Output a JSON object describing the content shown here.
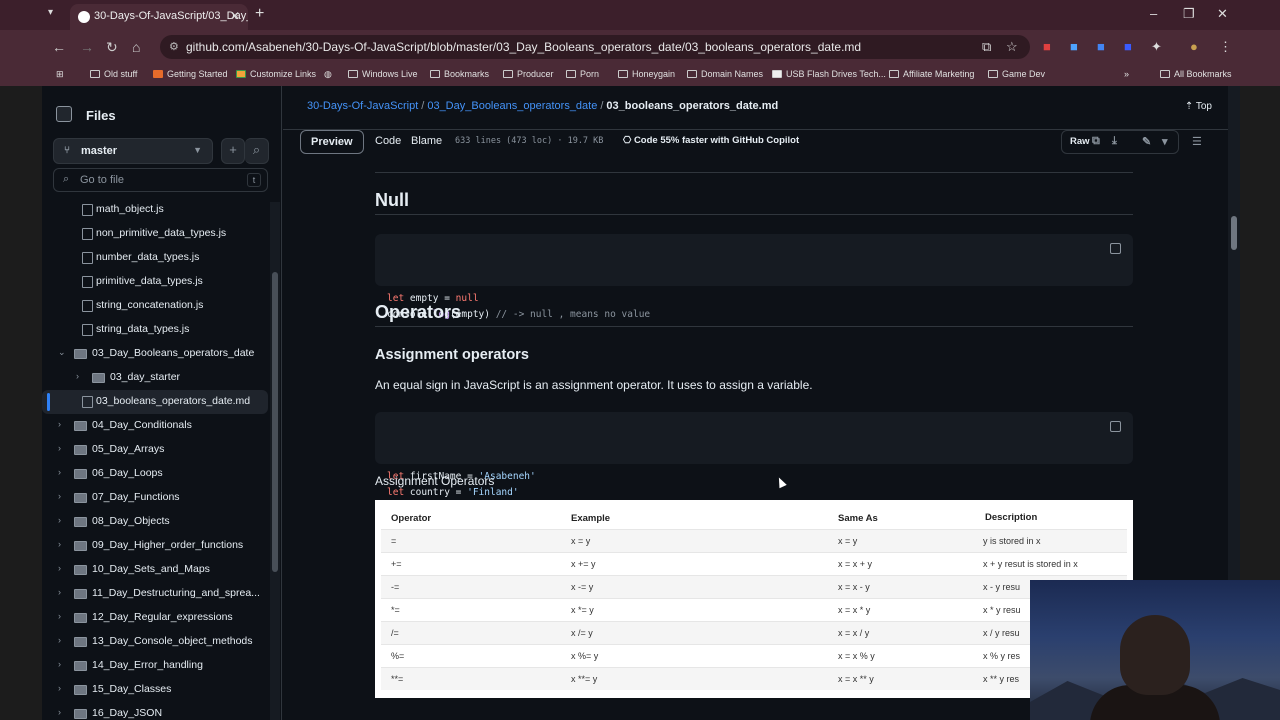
{
  "browser": {
    "tab_title": "30-Days-Of-JavaScript/03_Day_Bo...",
    "url": "github.com/Asabeneh/30-Days-Of-JavaScript/blob/master/03_Day_Booleans_operators_date/03_booleans_operators_date.md",
    "bookmarks": [
      "Old stuff",
      "Getting Started",
      "Customize Links",
      "Windows Live",
      "Bookmarks",
      "Producer",
      "Porn",
      "Honeygain",
      "Domain Names",
      "USB Flash Drives Tech...",
      "Affiliate Marketing",
      "Game Dev"
    ],
    "all_bookmarks": "All Bookmarks"
  },
  "sidebar": {
    "title": "Files",
    "branch": "master",
    "go_to_file": "Go to file",
    "go_to_file_key": "t",
    "items": [
      {
        "label": "math_object.js",
        "type": "file",
        "indent": 2
      },
      {
        "label": "non_primitive_data_types.js",
        "type": "file",
        "indent": 2
      },
      {
        "label": "number_data_types.js",
        "type": "file",
        "indent": 2
      },
      {
        "label": "primitive_data_types.js",
        "type": "file",
        "indent": 2
      },
      {
        "label": "string_concatenation.js",
        "type": "file",
        "indent": 2
      },
      {
        "label": "string_data_types.js",
        "type": "file",
        "indent": 2
      },
      {
        "label": "03_Day_Booleans_operators_date",
        "type": "folder-open",
        "indent": 1
      },
      {
        "label": "03_day_starter",
        "type": "folder",
        "indent": 2
      },
      {
        "label": "03_booleans_operators_date.md",
        "type": "file",
        "indent": 2,
        "selected": true
      },
      {
        "label": "04_Day_Conditionals",
        "type": "folder",
        "indent": 1
      },
      {
        "label": "05_Day_Arrays",
        "type": "folder",
        "indent": 1
      },
      {
        "label": "06_Day_Loops",
        "type": "folder",
        "indent": 1
      },
      {
        "label": "07_Day_Functions",
        "type": "folder",
        "indent": 1
      },
      {
        "label": "08_Day_Objects",
        "type": "folder",
        "indent": 1
      },
      {
        "label": "09_Day_Higher_order_functions",
        "type": "folder",
        "indent": 1
      },
      {
        "label": "10_Day_Sets_and_Maps",
        "type": "folder",
        "indent": 1
      },
      {
        "label": "11_Day_Destructuring_and_sprea...",
        "type": "folder",
        "indent": 1
      },
      {
        "label": "12_Day_Regular_expressions",
        "type": "folder",
        "indent": 1
      },
      {
        "label": "13_Day_Console_object_methods",
        "type": "folder",
        "indent": 1
      },
      {
        "label": "14_Day_Error_handling",
        "type": "folder",
        "indent": 1
      },
      {
        "label": "15_Day_Classes",
        "type": "folder",
        "indent": 1
      },
      {
        "label": "16_Day_JSON",
        "type": "folder",
        "indent": 1
      }
    ]
  },
  "breadcrumb": {
    "repo": "30-Days-Of-JavaScript",
    "folder": "03_Day_Booleans_operators_date",
    "file": "03_booleans_operators_date.md",
    "top": "Top"
  },
  "toolbar": {
    "preview": "Preview",
    "code": "Code",
    "blame": "Blame",
    "meta": "633 lines (473 loc) · 19.7 KB",
    "copilot": "Code 55% faster with GitHub Copilot",
    "raw": "Raw"
  },
  "content": {
    "null_heading": "Null",
    "null_code": [
      [
        {
          "c": "kw",
          "t": "let"
        },
        {
          "c": "tx",
          "t": " empty = "
        },
        {
          "c": "kw",
          "t": "null"
        }
      ],
      [
        {
          "c": "tx",
          "t": "console."
        },
        {
          "c": "fn",
          "t": "log"
        },
        {
          "c": "tx",
          "t": "(empty) "
        },
        {
          "c": "cm",
          "t": "// -> null , means no value"
        }
      ]
    ],
    "operators_heading": "Operators",
    "assignment_heading": "Assignment operators",
    "assignment_para": "An equal sign in JavaScript is an assignment operator. It uses to assign a variable.",
    "assignment_code": [
      [
        {
          "c": "kw",
          "t": "let"
        },
        {
          "c": "tx",
          "t": " firstName = "
        },
        {
          "c": "str",
          "t": "'Asabeneh'"
        }
      ],
      [
        {
          "c": "kw",
          "t": "let"
        },
        {
          "c": "tx",
          "t": " country = "
        },
        {
          "c": "str",
          "t": "'Finland'"
        }
      ]
    ],
    "table_caption": "Assignment Operators",
    "table_headers": [
      "Operator",
      "Example",
      "Same As",
      "Description"
    ],
    "table_rows": [
      [
        "=",
        "x = y",
        "x = y",
        "y  is stored in x"
      ],
      [
        "+=",
        "x += y",
        "x = x + y",
        "x  + y resut is stored in x"
      ],
      [
        "-=",
        "x -= y",
        "x = x - y",
        "x  - y resu"
      ],
      [
        "*=",
        "x *= y",
        "x = x * y",
        "x  * y resu"
      ],
      [
        "/=",
        "x /= y",
        "x = x / y",
        "x  /  y resu"
      ],
      [
        "%=",
        "x %= y",
        "x = x % y",
        "x  % y res"
      ],
      [
        "**=",
        "x **= y",
        "x = x ** y",
        "x  ** y res"
      ]
    ]
  }
}
